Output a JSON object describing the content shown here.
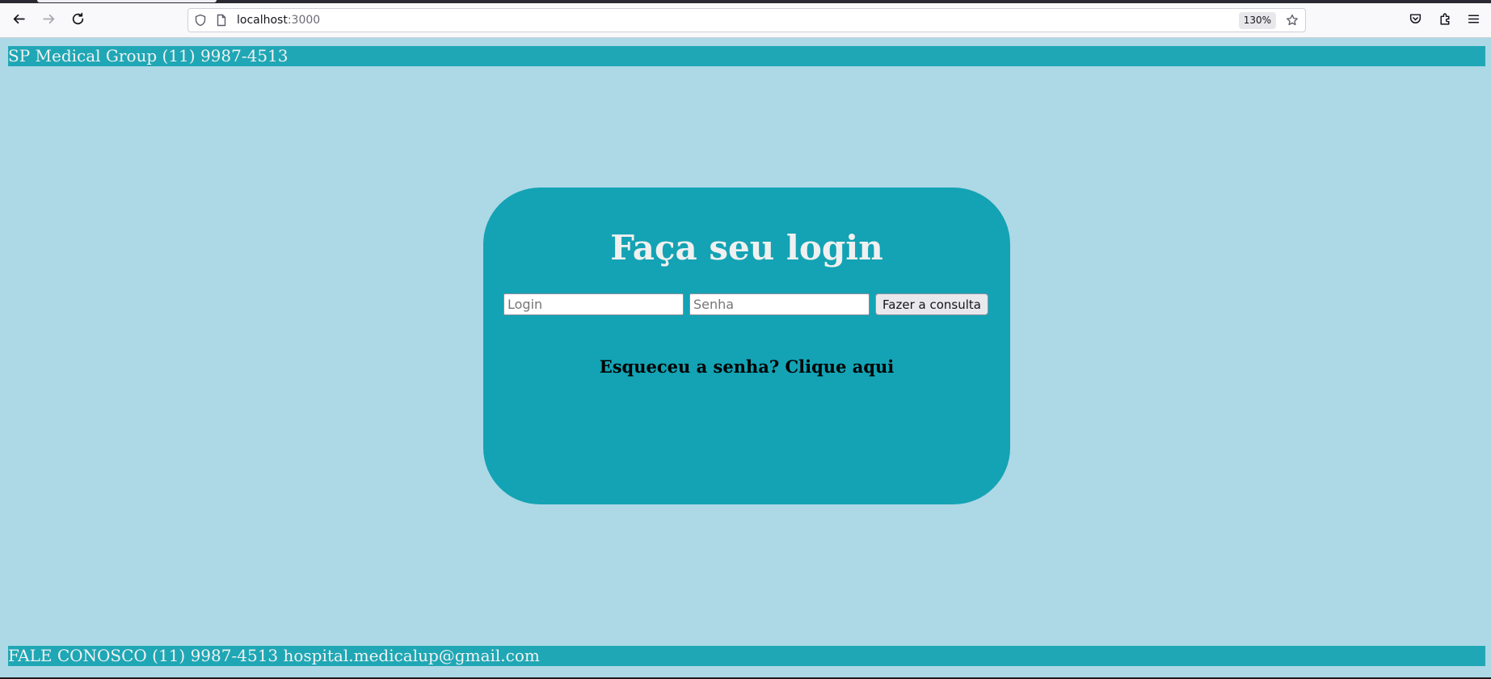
{
  "browser": {
    "url_host": "localhost",
    "url_port": ":3000",
    "zoom_level": "130%",
    "icons": {
      "back": "arrow-left-icon",
      "forward": "arrow-right-icon",
      "reload": "reload-icon",
      "security": "shield-icon",
      "page": "page-icon",
      "bookmark": "star-icon",
      "pocket": "pocket-icon",
      "extensions": "puzzle-icon",
      "menu": "hamburger-menu-icon"
    }
  },
  "header": {
    "text": "SP Medical Group (11) 9987-4513"
  },
  "login": {
    "title": "Faça seu login",
    "login_placeholder": "Login",
    "password_placeholder": "Senha",
    "submit_label": "Fazer a consulta",
    "forgot_link": "Esqueceu a senha? Clique aqui"
  },
  "footer": {
    "text": "FALE CONOSCO (11) 9987-4513 hospital.medicalup@gmail.com"
  },
  "colors": {
    "page_background": "#add8e6",
    "bar_background": "#20a7b5",
    "card_background": "#13a3b4",
    "bar_text": "#f2f2f2",
    "title_text": "#f0f0f0"
  }
}
